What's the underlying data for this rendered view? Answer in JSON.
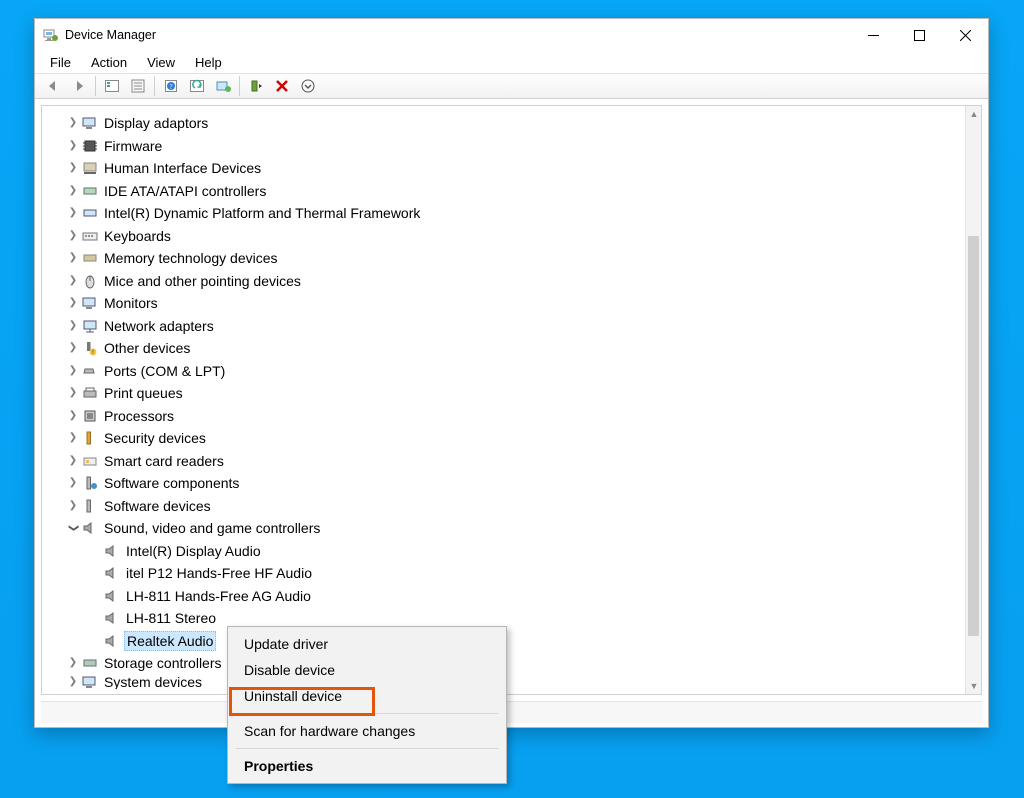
{
  "window": {
    "title": "Device Manager"
  },
  "menu": {
    "file": "File",
    "action": "Action",
    "view": "View",
    "help": "Help"
  },
  "tree": {
    "categories": [
      {
        "label": "Display adaptors",
        "icon": "monitor"
      },
      {
        "label": "Firmware",
        "icon": "chip"
      },
      {
        "label": "Human Interface Devices",
        "icon": "hid"
      },
      {
        "label": "IDE ATA/ATAPI controllers",
        "icon": "storage"
      },
      {
        "label": "Intel(R) Dynamic Platform and Thermal Framework",
        "icon": "thermal"
      },
      {
        "label": "Keyboards",
        "icon": "keyboard"
      },
      {
        "label": "Memory technology devices",
        "icon": "memory"
      },
      {
        "label": "Mice and other pointing devices",
        "icon": "mouse"
      },
      {
        "label": "Monitors",
        "icon": "monitor"
      },
      {
        "label": "Network adapters",
        "icon": "network"
      },
      {
        "label": "Other devices",
        "icon": "other"
      },
      {
        "label": "Ports (COM & LPT)",
        "icon": "port"
      },
      {
        "label": "Print queues",
        "icon": "printer"
      },
      {
        "label": "Processors",
        "icon": "cpu"
      },
      {
        "label": "Security devices",
        "icon": "security"
      },
      {
        "label": "Smart card readers",
        "icon": "smartcard"
      },
      {
        "label": "Software components",
        "icon": "software"
      },
      {
        "label": "Software devices",
        "icon": "software"
      }
    ],
    "expanded": {
      "label": "Sound, video and game controllers",
      "children": [
        "Intel(R) Display Audio",
        "itel P12 Hands-Free HF Audio",
        "LH-811 Hands-Free AG Audio",
        "LH-811 Stereo",
        "Realtek Audio"
      ]
    },
    "after": [
      {
        "label": "Storage controllers",
        "icon": "storage",
        "truncated": false
      },
      {
        "label": "System devices",
        "icon": "system",
        "truncated": true
      }
    ]
  },
  "context_menu": {
    "update": "Update driver",
    "disable": "Disable device",
    "uninstall": "Uninstall device",
    "scan": "Scan for hardware changes",
    "properties": "Properties"
  }
}
